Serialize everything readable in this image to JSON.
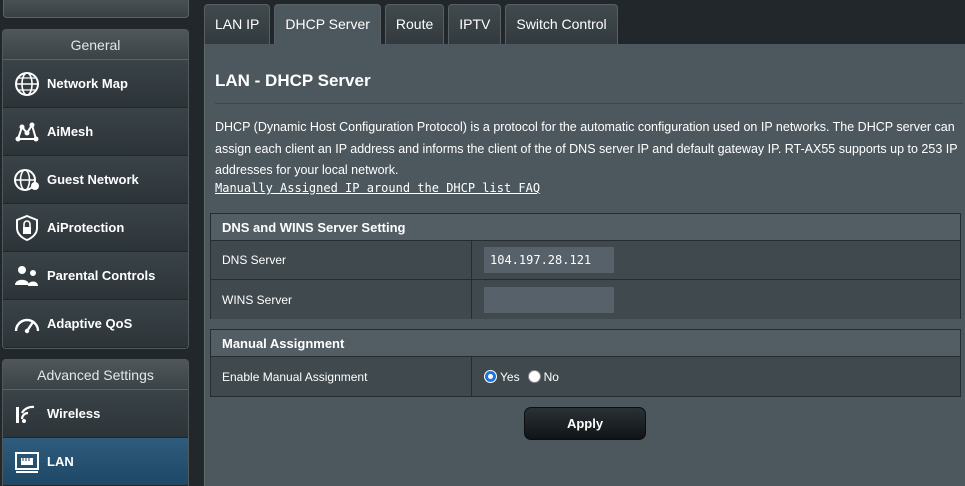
{
  "sidebar": {
    "general_title": "General",
    "general_items": [
      {
        "label": "Network Map",
        "icon": "network-map-icon"
      },
      {
        "label": "AiMesh",
        "icon": "aimesh-icon"
      },
      {
        "label": "Guest Network",
        "icon": "guest-network-icon"
      },
      {
        "label": "AiProtection",
        "icon": "aiprotection-icon"
      },
      {
        "label": "Parental Controls",
        "icon": "parental-controls-icon"
      },
      {
        "label": "Adaptive QoS",
        "icon": "adaptive-qos-icon"
      }
    ],
    "advanced_title": "Advanced Settings",
    "advanced_items": [
      {
        "label": "Wireless",
        "icon": "wireless-icon"
      },
      {
        "label": "LAN",
        "icon": "lan-icon",
        "active": true
      }
    ]
  },
  "tabs": [
    {
      "label": "LAN IP"
    },
    {
      "label": "DHCP Server",
      "active": true
    },
    {
      "label": "Route"
    },
    {
      "label": "IPTV"
    },
    {
      "label": "Switch Control"
    }
  ],
  "page": {
    "title": "LAN - DHCP Server",
    "description": "DHCP (Dynamic Host Configuration Protocol) is a protocol for the automatic configuration used on IP networks. The DHCP server can assign each client an IP address and informs the client of the of DNS server IP and default gateway IP. RT-AX55 supports up to 253 IP addresses for your local network.",
    "faq_link": "Manually Assigned IP around the DHCP list FAQ"
  },
  "dns_section": {
    "title": "DNS and WINS Server Setting",
    "dns_label": "DNS Server",
    "dns_value": "104.197.28.121",
    "wins_label": "WINS Server",
    "wins_value": ""
  },
  "manual_section": {
    "title": "Manual Assignment",
    "enable_label": "Enable Manual Assignment",
    "yes_label": "Yes",
    "no_label": "No",
    "selected": "Yes"
  },
  "apply_label": "Apply",
  "colors": {
    "accent_active": "#1f4766",
    "content_bg": "#4d585e",
    "radio_selected": "#1f73e0"
  }
}
